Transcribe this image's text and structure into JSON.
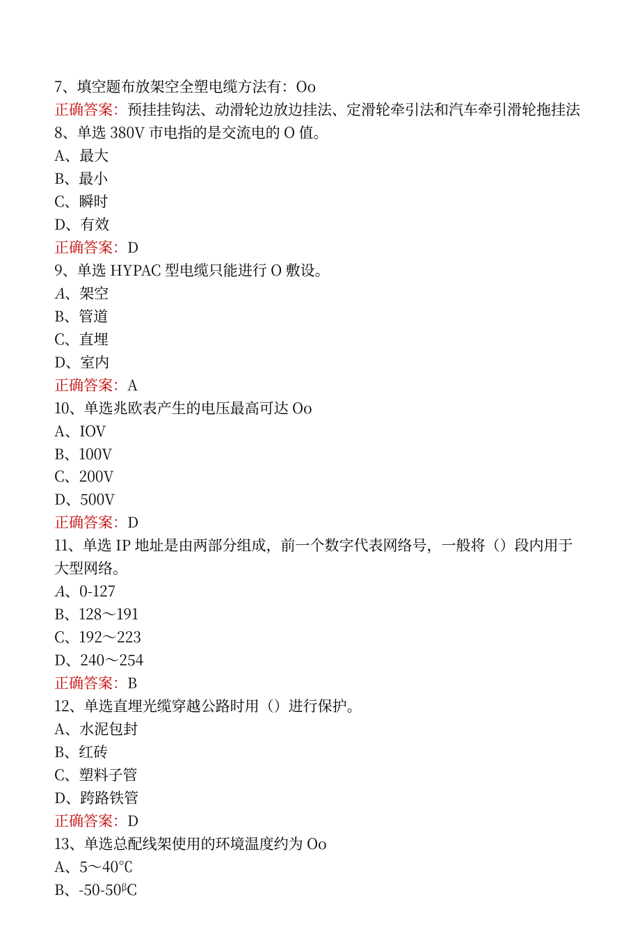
{
  "q7": {
    "text": "7、填空题布放架空全塑电缆方法有：Oo",
    "answer_label": "正确答案：",
    "answer_value": "预挂挂钩法、动滑轮边放边挂法、定滑轮牵引法和汽车牵引滑轮拖挂法"
  },
  "q8": {
    "text": "8、单选 380V 市电指的是交流电的 O 值。",
    "opts": {
      "A": "A、最大",
      "B": "B、最小",
      "C": "C、瞬时",
      "D": "D、有效"
    },
    "answer_label": "正确答案：",
    "answer_value": "D"
  },
  "q9": {
    "text": "9、单选 HYPAC 型电缆只能进行 O 敷设。",
    "opts": {
      "A_letter": "A",
      "A_rest": "、架空",
      "B": "B、管道",
      "C": "C、直埋",
      "D": "D、室内"
    },
    "answer_label": "正确答案：",
    "answer_value": "A"
  },
  "q10": {
    "text": "10、单选兆欧表产生的电压最高可达 Oo",
    "opts": {
      "A": "A、IOV",
      "B": "B、100V",
      "C": "C、200V",
      "D": "D、500V"
    },
    "answer_label": "正确答案：",
    "answer_value": "D"
  },
  "q11": {
    "text": "11、单选 IP 地址是由两部分组成，前一个数字代表网络号，一般将（）段内用于大型网络。",
    "opts": {
      "A_letter": "A",
      "A_rest": "、0-127",
      "B": "B、128～191",
      "C": "C、192～223",
      "D": "D、240～254"
    },
    "answer_label": "正确答案：",
    "answer_value": "B"
  },
  "q12": {
    "text": "12、单选直埋光缆穿越公路时用（）进行保护。",
    "opts": {
      "A": "A、水泥包封",
      "B": "B、红砖",
      "C": "C、塑料子管",
      "D": "D、跨路铁管"
    },
    "answer_label": "正确答案：",
    "answer_value": "D"
  },
  "q13": {
    "text": "13、单选总配线架使用的环境温度约为 Oo",
    "opts": {
      "A": "A、5～40℃",
      "B_prefix": "B、-50-50",
      "B_sup": "β",
      "B_suffix": "C"
    }
  }
}
